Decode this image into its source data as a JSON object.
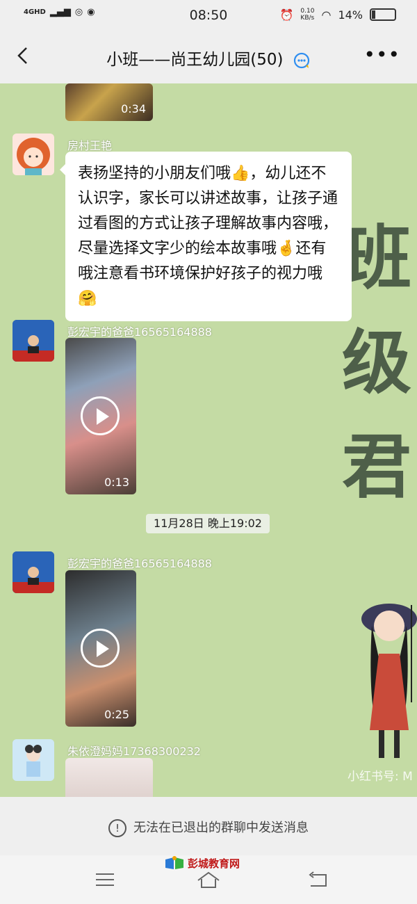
{
  "status_bar": {
    "network": "4GHD",
    "time": "08:50",
    "net_speed": "0.10\nKB/s",
    "battery": "14%",
    "battery_level": 0.14
  },
  "header": {
    "title": "小班——尚王幼儿园(50)",
    "back_icon": "chevron-left-icon",
    "more_icon": "ellipsis-icon"
  },
  "messages": [
    {
      "type": "video",
      "duration": "0:34"
    },
    {
      "type": "text",
      "sender": "房村王艳",
      "text": "表扬坚持的小朋友们哦👍，幼儿还不认识字，家长可以讲述故事，让孩子通过看图的方式让孩子理解故事内容哦，尽量选择文字少的绘本故事哦🤞还有哦注意看书环境保护好孩子的视力哦🤗"
    },
    {
      "type": "video",
      "sender": "彭宏宇的爸爸16565164888",
      "duration": "0:13"
    },
    {
      "type": "timestamp",
      "text": "11月28日 晚上19:02"
    },
    {
      "type": "video",
      "sender": "彭宏宇的爸爸16565164888",
      "duration": "0:25"
    },
    {
      "type": "image",
      "sender": "朱依澄妈妈17368300232"
    }
  ],
  "wallpaper": {
    "chars": [
      "班",
      "级",
      "君"
    ],
    "watermark": "小红书号: M"
  },
  "footer": {
    "notice": "无法在已退出的群聊中发送消息"
  },
  "navbar": {
    "logo": "彭城教育网"
  },
  "colors": {
    "chat_bg": "#c4dba4",
    "bar_bg": "#efefef",
    "bubble": "#ffffff"
  }
}
